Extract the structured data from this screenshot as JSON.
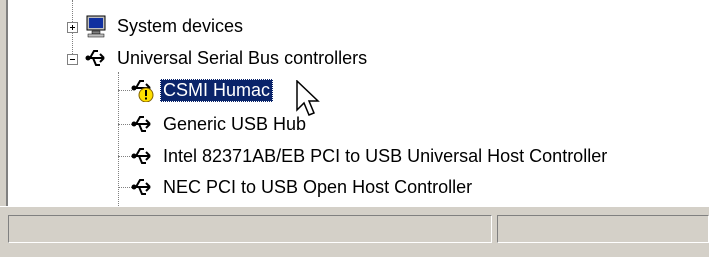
{
  "tree": {
    "items": [
      {
        "label": "System devices",
        "expanded": false,
        "icon": "monitor-icon"
      },
      {
        "label": "Universal Serial Bus controllers",
        "expanded": true,
        "icon": "usb-icon"
      }
    ],
    "usb_children": [
      {
        "label": "CSMI Humac",
        "icon": "usb-warning-icon",
        "selected": true
      },
      {
        "label": "Generic USB Hub",
        "icon": "usb-icon",
        "selected": false
      },
      {
        "label": "Intel 82371AB/EB PCI to USB Universal Host Controller",
        "icon": "usb-icon",
        "selected": false
      },
      {
        "label": "NEC PCI to USB Open Host Controller",
        "icon": "usb-icon",
        "selected": false
      }
    ]
  },
  "statusbar": {
    "pane1": "",
    "pane2": ""
  },
  "colors": {
    "selection": "#0a246a",
    "window": "#ffffff",
    "face": "#d4d0c8"
  }
}
